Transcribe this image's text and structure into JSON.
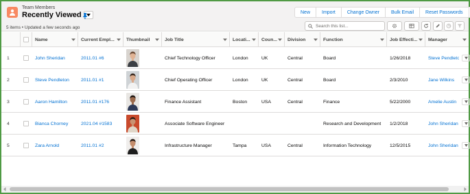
{
  "header": {
    "object_label": "Team Members",
    "list_view_name": "Recently Viewed",
    "status": "5 items • Updated a few seconds ago",
    "icons": {
      "object": "team-members-icon",
      "pin": "pin-icon",
      "caret": "chevron-down-icon"
    }
  },
  "actions": {
    "buttons": [
      "New",
      "Import",
      "Change Owner",
      "Bulk Email",
      "Reset Passwords"
    ],
    "more_icon": "chevron-down-icon"
  },
  "search": {
    "placeholder": "Search this list..."
  },
  "toolbar_icons": [
    "settings-icon",
    "display-as-table-icon",
    "refresh-icon",
    "edit-icon",
    "chart-icon",
    "filter-icon"
  ],
  "columns": [
    "",
    "",
    "Name",
    "Current Empl...",
    "Thumbnail",
    "Job Title",
    "Locati...",
    "Coun...",
    "Division",
    "Function",
    "Job Effecti...",
    "Manager"
  ],
  "rows": [
    {
      "num": "1",
      "name": "John Sheridan",
      "emp": "2011.01 #6",
      "photo": "portrait-1",
      "title": "Chief Technology Officer",
      "location": "London",
      "country": "UK",
      "division": "Central",
      "function": "Board",
      "date": "1/26/2018",
      "manager": "Steve Pendleton"
    },
    {
      "num": "2",
      "name": "Steve Pendleton",
      "emp": "2011.01 #1",
      "photo": "portrait-2",
      "title": "Chief Operating Officer",
      "location": "London",
      "country": "UK",
      "division": "Central",
      "function": "Board",
      "date": "2/3/2010",
      "manager": "Jane Wilkins"
    },
    {
      "num": "3",
      "name": "Aaron Hamilton",
      "emp": "2011.01 #176",
      "photo": "portrait-3",
      "title": "Finance Assistant",
      "location": "Boston",
      "country": "USA",
      "division": "Central",
      "function": "Finance",
      "date": "5/22/2000",
      "manager": "Amelie Austin"
    },
    {
      "num": "4",
      "name": "Bianca Chorney",
      "emp": "2021.04 #1583",
      "photo": "portrait-4",
      "title": "Associate Software Engineer",
      "location": "",
      "country": "",
      "division": "",
      "function": "Research and Development",
      "date": "1/2/2018",
      "manager": "John Sheridan"
    },
    {
      "num": "5",
      "name": "Zara Arnold",
      "emp": "2011.01 #2",
      "photo": "portrait-5",
      "title": "Infrastructure Manager",
      "location": "Tampa",
      "country": "USA",
      "division": "Central",
      "function": "Information Technology",
      "date": "12/5/2015",
      "manager": "John Sheridan"
    }
  ],
  "colors": {
    "accent": "#0070d2",
    "border": "#dddbda",
    "header_bg": "#f3f2f2",
    "object_icon": "#f88962",
    "frame": "#4f9a44"
  }
}
